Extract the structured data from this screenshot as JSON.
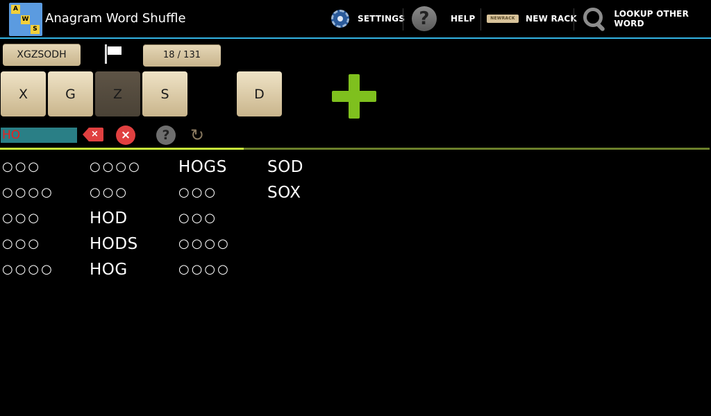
{
  "app": {
    "title": "Anagram Word Shuffle",
    "icon_letters": [
      "A",
      "W",
      "S"
    ]
  },
  "actionbar": {
    "settings_label": "SETTINGS",
    "help_label": "HELP",
    "help_icon_glyph": "?",
    "new_rack_icon_text": "NEWRACK",
    "new_rack_label": "NEW RACK",
    "lookup_label": "LOOKUP OTHER WORD"
  },
  "rack": {
    "letters_label": "XGZSODH",
    "counter": "18 / 131",
    "tiles": [
      "X",
      "G",
      "Z",
      "S",
      "D"
    ]
  },
  "input": {
    "current_guess": "HO",
    "backspace_glyph": "×",
    "clear_glyph": "×",
    "hint_glyph": "?",
    "refresh_glyph": "↻"
  },
  "progress": {
    "found": 18,
    "total": 131
  },
  "words": {
    "columns": [
      [
        "○○○",
        "○○○○",
        "○○○",
        "○○○",
        "○○○○"
      ],
      [
        "○○○○",
        "○○○",
        "HOD",
        "HODS",
        "HOG"
      ],
      [
        "HOGS",
        "○○○",
        "○○○",
        "○○○○",
        "○○○○"
      ],
      [
        "SOD",
        "SOX"
      ]
    ]
  },
  "colors": {
    "accent_line": "#33b5e5",
    "progress_fill": "#c8f23a",
    "plus_green": "#7fc01e",
    "guess_text": "#e82020"
  }
}
